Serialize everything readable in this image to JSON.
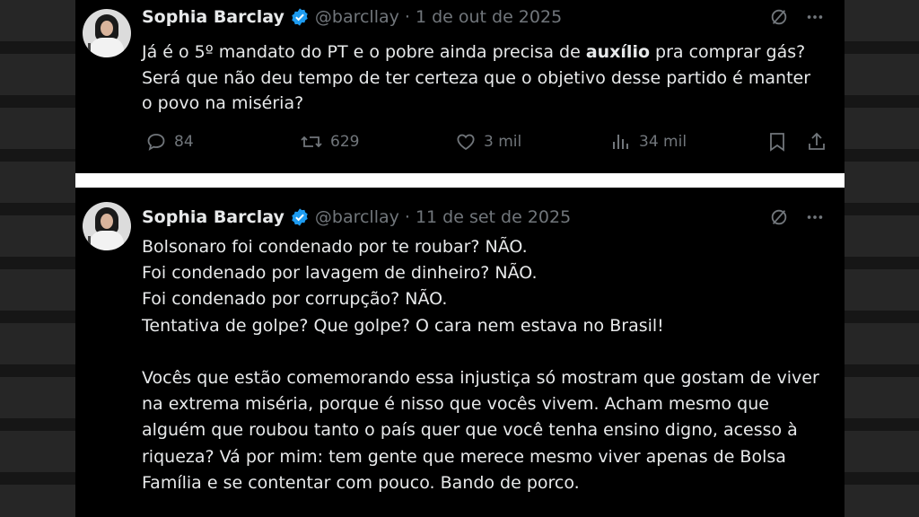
{
  "colors": {
    "background": "#000000",
    "text": "#e7e9ea",
    "muted": "#71767b",
    "verified": "#1d9bf0"
  },
  "tweets": [
    {
      "author_name": "Sophia Barclay",
      "handle": "@barcllay",
      "separator": "·",
      "date": "1 de out de 2025",
      "text_before": "Já é o 5º mandato do PT e o pobre ainda precisa de ",
      "text_bold": "auxílio",
      "text_after": " pra comprar gás? Será que não deu tempo de ter certeza que o objetivo desse partido é manter o povo na miséria?",
      "replies": "84",
      "reposts": "629",
      "likes": "3 mil",
      "views": "34 mil",
      "icons": [
        "verified-badge-icon",
        "grok-icon",
        "more-icon",
        "reply-icon",
        "repost-icon",
        "like-icon",
        "views-icon",
        "bookmark-icon",
        "share-icon"
      ]
    },
    {
      "author_name": "Sophia Barclay",
      "handle": "@barcllay",
      "separator": "·",
      "date": "11 de set de 2025",
      "text": "Bolsonaro foi condenado por te roubar? NÃO.\nFoi condenado por lavagem de dinheiro? NÃO.\nFoi condenado por corrupção? NÃO.\nTentativa de golpe? Que golpe? O cara nem estava no Brasil!\n\nVocês que estão comemorando essa injustiça só mostram que gostam de viver na extrema miséria, porque é nisso que vocês vivem. Acham mesmo que alguém que roubou tanto o país quer que você tenha ensino digno, acesso à riqueza? Vá por mim: tem gente que merece mesmo viver apenas de Bolsa Família e se contentar com pouco. Bando de porco."
    }
  ]
}
